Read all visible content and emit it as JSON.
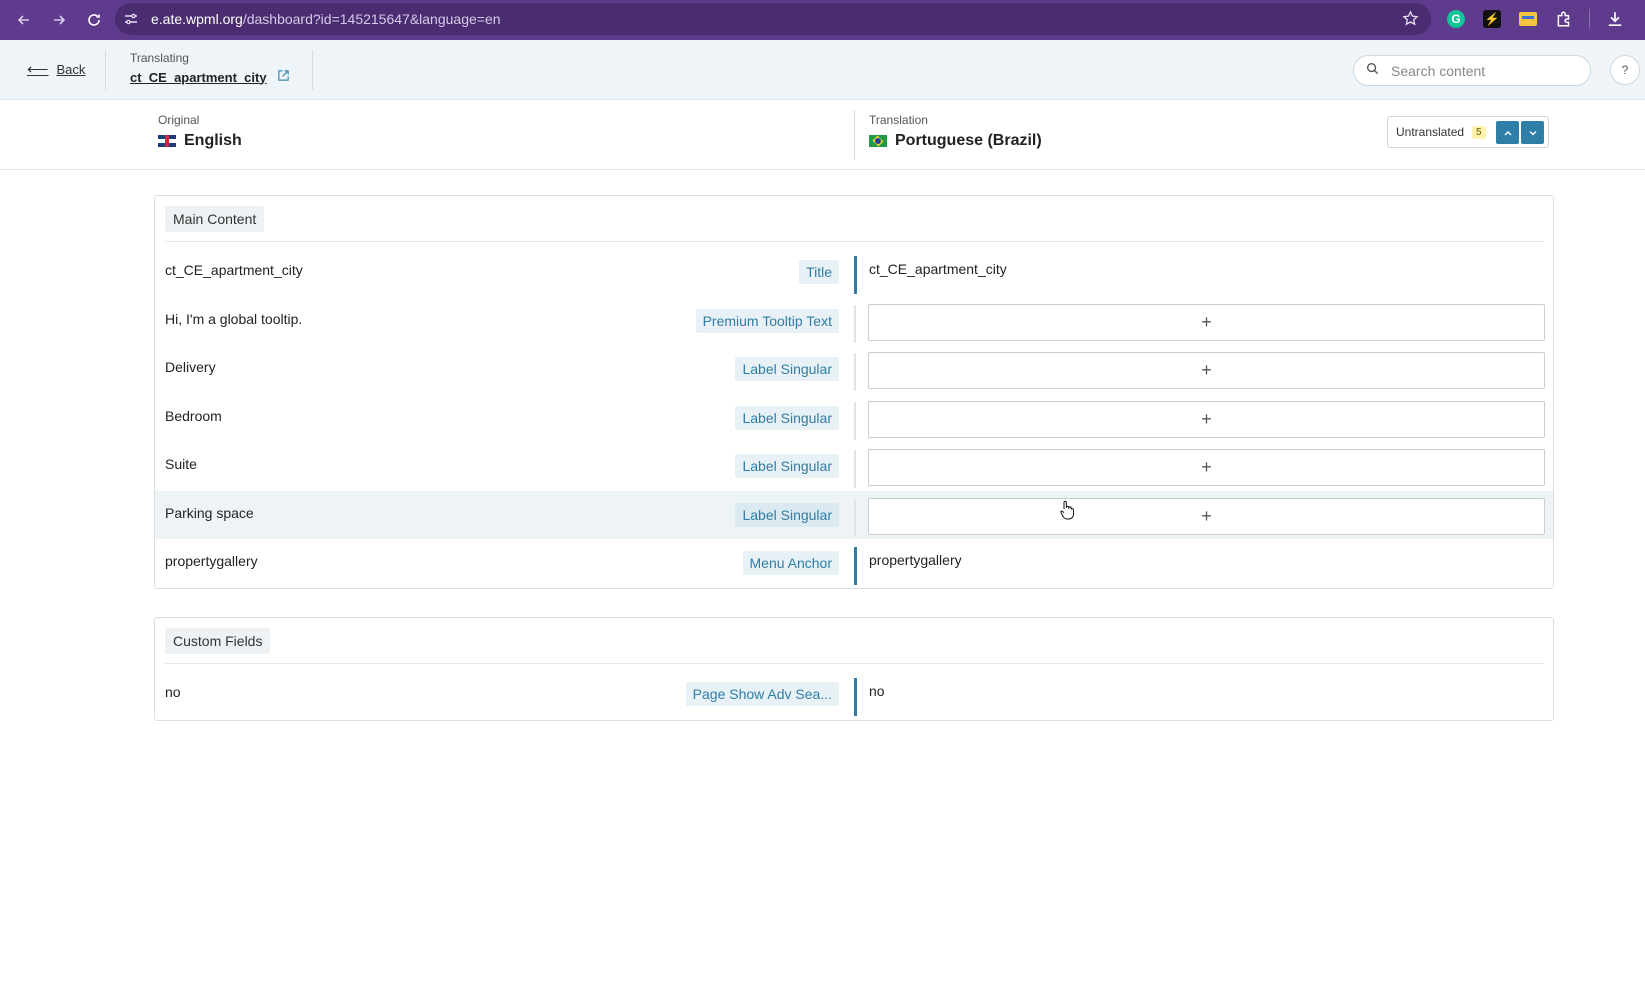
{
  "browser": {
    "url_host": "e.ate.wpml.org",
    "url_path": "/dashboard?id=145215647&language=en",
    "back_icon": "arrow-left-icon",
    "forward_icon": "arrow-right-icon",
    "reload_icon": "reload-icon",
    "extensions": [
      "grammarly-icon",
      "bolt-icon",
      "card-icon",
      "puzzle-icon"
    ]
  },
  "header": {
    "back_label": "Back",
    "translating_label": "Translating",
    "document_name": "ct_CE_apartment_city",
    "search_placeholder": "Search content",
    "help_label": "?"
  },
  "languages": {
    "original_label": "Original",
    "original_value": "English",
    "translation_label": "Translation",
    "translation_value": "Portuguese (Brazil)",
    "filter_label": "Untranslated",
    "filter_count": "5"
  },
  "colors": {
    "accent": "#2e7ea7",
    "browser_frame": "#5e3b8c",
    "header_bg": "#eef4f7"
  },
  "sections": [
    {
      "title": "Main Content",
      "rows": [
        {
          "source": "ct_CE_apartment_city",
          "tag": "Title",
          "translation": "ct_CE_apartment_city"
        },
        {
          "source": "Hi, I'm a global tooltip.",
          "tag": "Premium Tooltip Text",
          "translation": "+"
        },
        {
          "source": "Delivery",
          "tag": "Label Singular",
          "translation": "+"
        },
        {
          "source": "Bedroom",
          "tag": "Label Singular",
          "translation": "+"
        },
        {
          "source": "Suite",
          "tag": "Label Singular",
          "translation": "+"
        },
        {
          "source": "Parking space",
          "tag": "Label Singular",
          "translation": "+"
        },
        {
          "source": "propertygallery",
          "tag": "Menu Anchor",
          "translation": "propertygallery"
        }
      ]
    },
    {
      "title": "Custom Fields",
      "rows": [
        {
          "source": "no",
          "tag": "Page Show Adv Sea...",
          "translation": "no"
        }
      ]
    }
  ]
}
